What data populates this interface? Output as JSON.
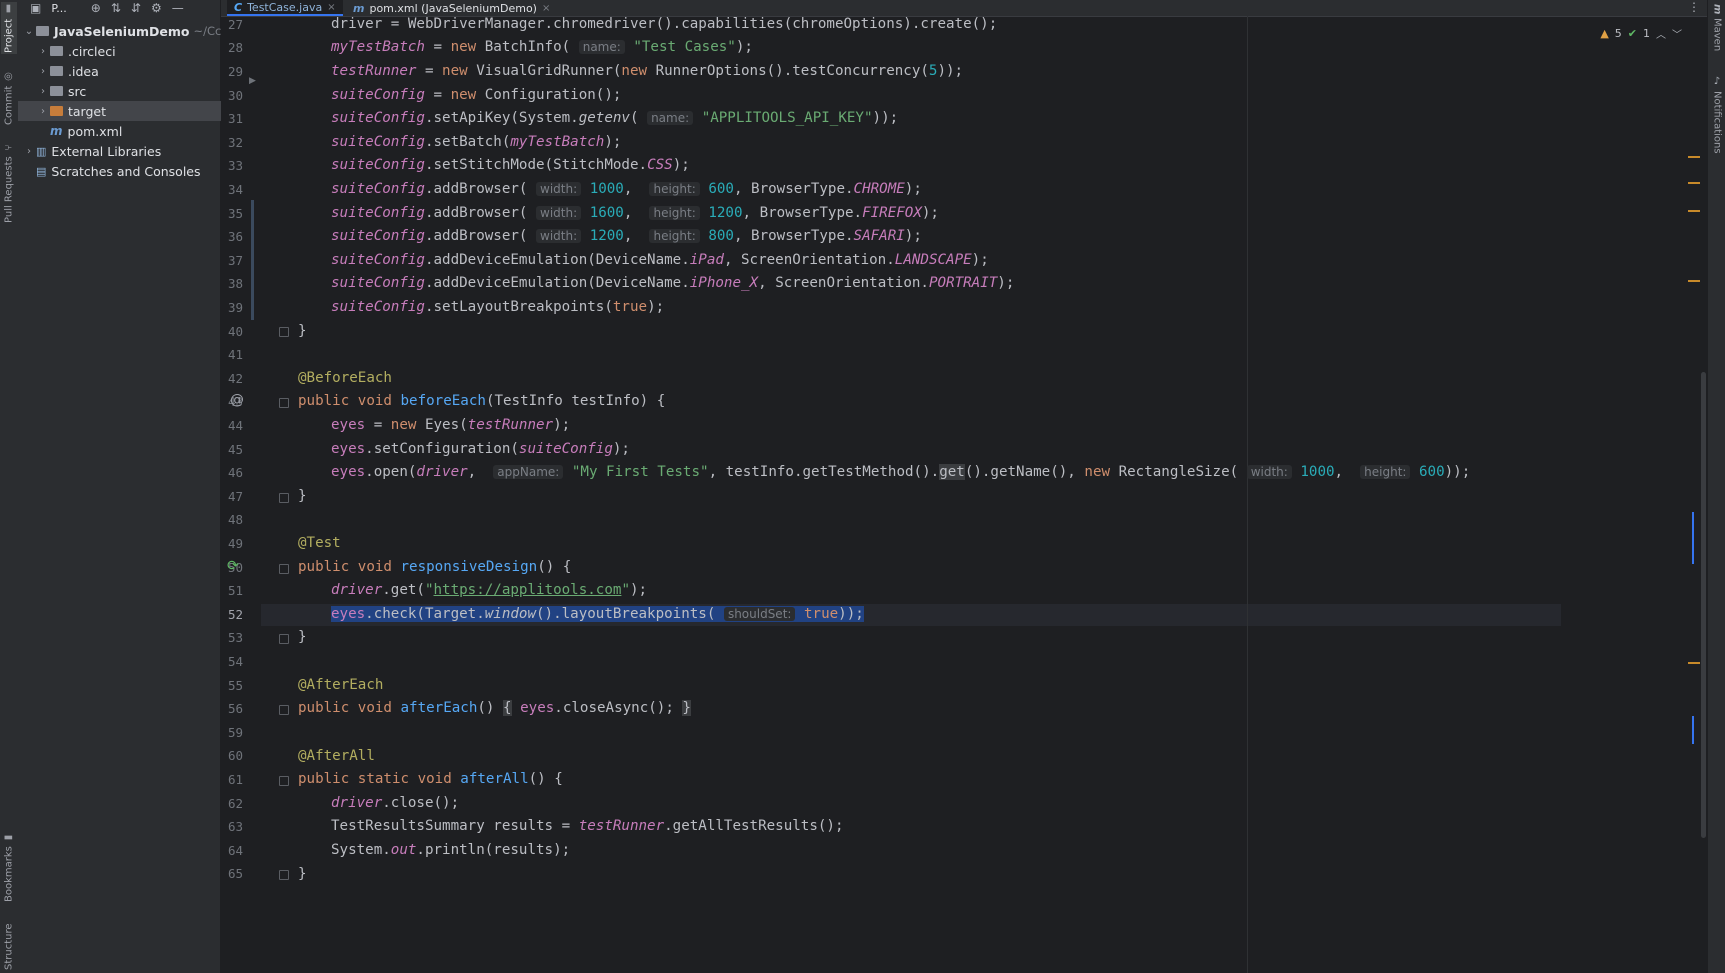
{
  "left_strip": {
    "project": "Project",
    "commit": "Commit",
    "pull_requests": "Pull Requests",
    "bookmarks": "Bookmarks",
    "structure": "Structure"
  },
  "project_panel": {
    "title": "P...",
    "root": {
      "name": "JavaSeleniumDemo",
      "path": "~/Cc"
    },
    "items": [
      {
        "label": ".circleci",
        "icon": "folder-icon"
      },
      {
        "label": ".idea",
        "icon": "folder-icon"
      },
      {
        "label": "src",
        "icon": "folder-icon"
      },
      {
        "label": "target",
        "icon": "folder-orange-icon"
      },
      {
        "label": "pom.xml",
        "icon": "maven-file-icon"
      },
      {
        "label": "External Libraries",
        "icon": "libraries-icon"
      },
      {
        "label": "Scratches and Consoles",
        "icon": "scratches-icon"
      }
    ]
  },
  "tabs": [
    {
      "label": "TestCase.java",
      "active": true
    },
    {
      "label": "pom.xml (JavaSeleniumDemo)",
      "active": false
    }
  ],
  "inspections": {
    "warnings": "5",
    "ok": "1"
  },
  "right_strip": {
    "maven": "Maven",
    "notifications": "Notifications"
  },
  "line_numbers": [
    "27",
    "28",
    "29",
    "30",
    "31",
    "32",
    "33",
    "34",
    "35",
    "36",
    "37",
    "38",
    "39",
    "40",
    "41",
    "42",
    "43",
    "44",
    "45",
    "46",
    "47",
    "48",
    "49",
    "50",
    "51",
    "52",
    "53",
    "54",
    "55",
    "56",
    "59",
    "60",
    "61",
    "62",
    "63",
    "64",
    "65"
  ],
  "current_line": "52",
  "code": {
    "l27": "driver = WebDriverManager.chromedriver().capabilities(chromeOptions).create();",
    "hint_name": "name:",
    "s_test_cases": "\"Test Cases\"",
    "s_api_key": "\"APPLITOOLS_API_KEY\"",
    "hint_width": "width:",
    "hint_height": "height:",
    "hint_appname": "appName:",
    "hint_shouldset": "shouldSet:",
    "s_first_tests": "\"My First Tests\"",
    "s_url": "https://applitools.com",
    "n1000": "1000",
    "n600": "600",
    "n1600": "1600",
    "n1200": "1200",
    "n800": "800",
    "n5": "5"
  },
  "colors": {
    "background": "#1e1f22",
    "keyword": "#cf8e6d",
    "string": "#6aab73",
    "number": "#2aacb8",
    "field": "#c77dbb",
    "method": "#56a8f5",
    "annotation": "#b3ae60",
    "selection": "#214283"
  }
}
